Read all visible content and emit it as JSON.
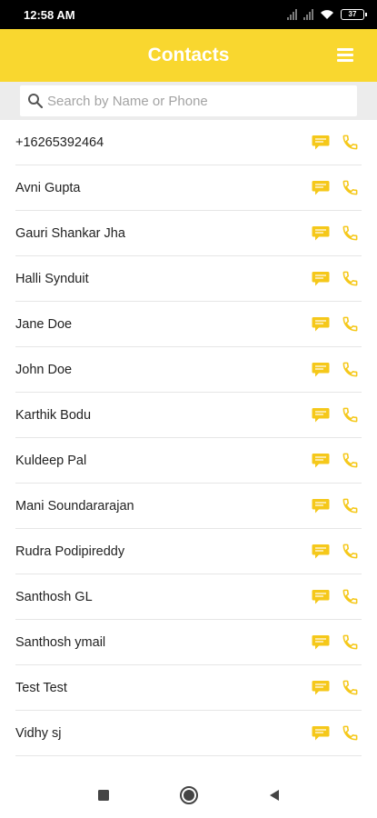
{
  "status_bar": {
    "time": "12:58 AM",
    "battery_level": "37"
  },
  "app_bar": {
    "title": "Contacts",
    "menu_icon": "hamburger-menu-icon"
  },
  "search": {
    "placeholder": "Search by Name or Phone",
    "value": ""
  },
  "contacts": [
    {
      "name": "+16265392464"
    },
    {
      "name": "Avni Gupta"
    },
    {
      "name": "Gauri Shankar Jha"
    },
    {
      "name": "Halli Synduit"
    },
    {
      "name": "Jane Doe"
    },
    {
      "name": "John Doe"
    },
    {
      "name": "Karthik Bodu"
    },
    {
      "name": "Kuldeep Pal"
    },
    {
      "name": "Mani Soundararajan"
    },
    {
      "name": "Rudra Podipireddy"
    },
    {
      "name": "Santhosh GL"
    },
    {
      "name": "Santhosh ymail"
    },
    {
      "name": "Test Test"
    },
    {
      "name": "Vidhy sj"
    }
  ],
  "row_actions": {
    "message_icon": "message-icon",
    "call_icon": "phone-icon"
  },
  "colors": {
    "accent": "#f9d72f",
    "icon": "#f5c81a",
    "status_bar": "#000000"
  },
  "nav_bar": {
    "recents_icon": "square-icon",
    "home_icon": "circle-icon",
    "back_icon": "triangle-back-icon"
  }
}
